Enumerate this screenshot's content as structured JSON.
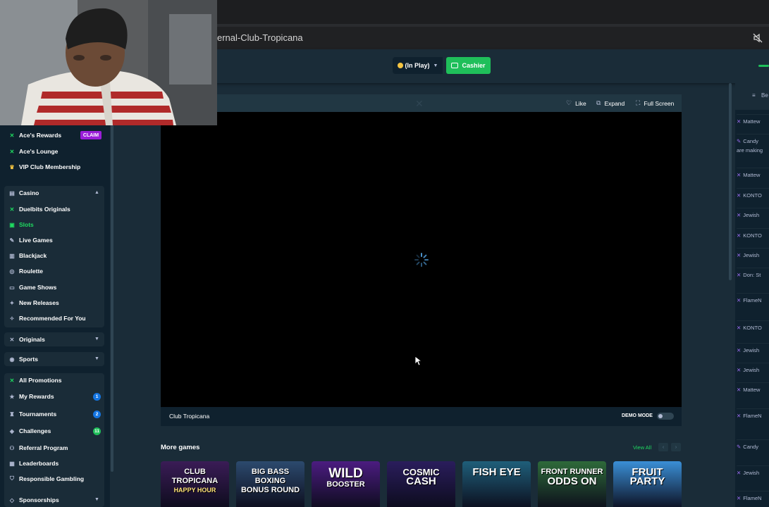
{
  "browser": {
    "title": "ernal-Club-Tropicana"
  },
  "header": {
    "balance_label": "(In Play)",
    "cashier_label": "Cashier"
  },
  "sidebar": {
    "top_items": [
      {
        "label": "Ace's Rewards",
        "icon": "ace-icon",
        "badge": "CLAIM"
      },
      {
        "label": "Ace's Lounge",
        "icon": "ace-icon"
      },
      {
        "label": "VIP Club Membership",
        "icon": "crown-icon"
      }
    ],
    "casino": {
      "label": "Casino",
      "items": [
        {
          "label": "Duelbits Originals",
          "icon": "ace-icon"
        },
        {
          "label": "Slots",
          "icon": "slot-icon",
          "active": true
        },
        {
          "label": "Live Games",
          "icon": "live-icon"
        },
        {
          "label": "Blackjack",
          "icon": "cards-icon"
        },
        {
          "label": "Roulette",
          "icon": "roulette-icon"
        },
        {
          "label": "Game Shows",
          "icon": "tv-icon"
        },
        {
          "label": "New Releases",
          "icon": "star-icon"
        },
        {
          "label": "Recommended For You",
          "icon": "recommend-icon"
        }
      ]
    },
    "originals": {
      "label": "Originals"
    },
    "sports": {
      "label": "Sports"
    },
    "promo_items": [
      {
        "label": "All Promotions",
        "icon": "ace-icon"
      },
      {
        "label": "My Rewards",
        "icon": "reward-icon",
        "badge": "1"
      },
      {
        "label": "Tournaments",
        "icon": "trophy-icon",
        "badge": "2"
      },
      {
        "label": "Challenges",
        "icon": "challenge-icon",
        "badge": "11"
      },
      {
        "label": "Referral Program",
        "icon": "referral-icon"
      },
      {
        "label": "Leaderboards",
        "icon": "leaderboard-icon"
      },
      {
        "label": "Responsible Gambling",
        "icon": "shield-icon"
      },
      {
        "label": "Sponsorships",
        "icon": "sponsor-icon"
      }
    ]
  },
  "game": {
    "tools": {
      "like": "Like",
      "expand": "Expand",
      "fullscreen": "Full Screen"
    },
    "name": "Club Tropicana",
    "demo_mode": "DEMO MODE",
    "demo_enabled": false
  },
  "more_games": {
    "title": "More games",
    "view_all": "View All",
    "tiles": [
      {
        "line1": "CLUB TROPICANA",
        "line2": "HAPPY HOUR",
        "bg": "#3a1c56"
      },
      {
        "line1": "BIG BASS BOXING",
        "line2": "BONUS ROUND",
        "bg": "#2c4a6e"
      },
      {
        "line1": "WILD",
        "line2": "BOOSTER",
        "bg": "#4b1c80"
      },
      {
        "line1": "COSMIC",
        "line2": "CASH",
        "bg": "#2a1d5c"
      },
      {
        "line1": "FISH EYE",
        "line2": "",
        "bg": "#1f5f7a"
      },
      {
        "line1": "FRONT RUNNER",
        "line2": "ODDS ON",
        "bg": "#2e6a3a"
      },
      {
        "line1": "FRUIT",
        "line2": "PARTY",
        "bg": "#3a8fd6"
      }
    ]
  },
  "chat": {
    "header": "Be",
    "messages": [
      {
        "user": "Mattew",
        "icon": "ace-icon"
      },
      {
        "user": "Candy",
        "text": "are making",
        "icon": "pen-icon"
      },
      {
        "user": "Mattew",
        "icon": "ace-icon"
      },
      {
        "user": "KONTO",
        "icon": "ace-icon"
      },
      {
        "user": "Jewish",
        "icon": "ace-icon"
      },
      {
        "user": "KONTO",
        "icon": "ace-icon"
      },
      {
        "user": "Jewish",
        "icon": "ace-icon"
      },
      {
        "user": "Don: St",
        "icon": "ace-icon"
      },
      {
        "user": "FlameN",
        "icon": "ace-icon"
      },
      {
        "user": "KONTO",
        "icon": "ace-icon"
      },
      {
        "user": "Jewish",
        "icon": "ace-icon"
      },
      {
        "user": "Jewish",
        "icon": "ace-icon"
      },
      {
        "user": "Mattew",
        "icon": "ace-icon"
      },
      {
        "user": "FlameN",
        "icon": "ace-icon"
      },
      {
        "user": "Candy",
        "icon": "pen-icon"
      },
      {
        "user": "Jewish",
        "icon": "ace-icon"
      },
      {
        "user": "FlameN",
        "icon": "ace-icon"
      }
    ]
  }
}
